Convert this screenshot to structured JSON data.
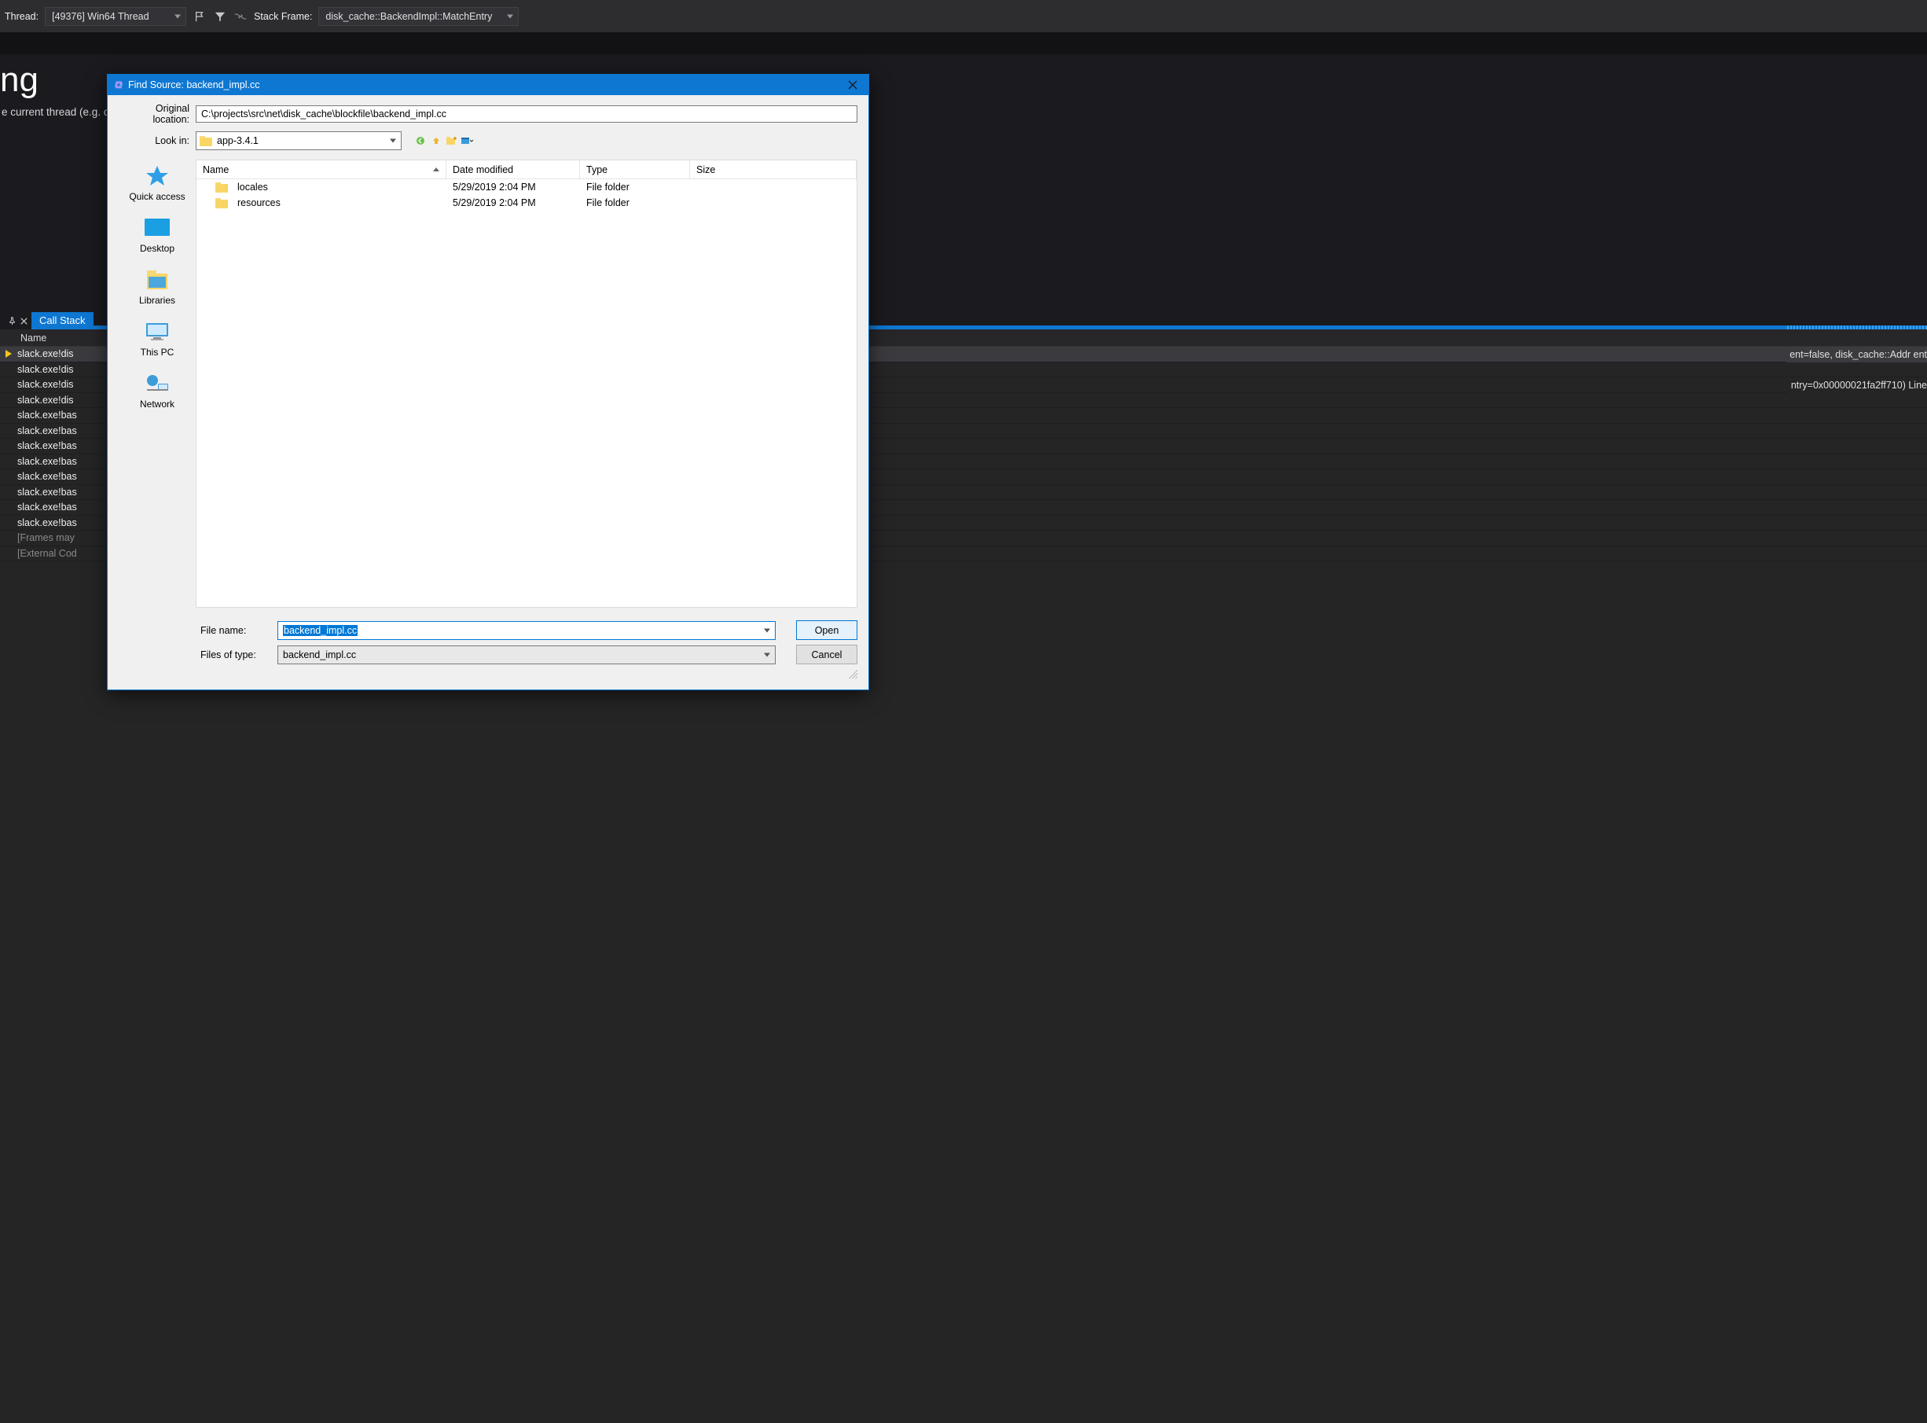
{
  "toolbar": {
    "thread_label": "Thread:",
    "thread_value": "[49376] Win64 Thread",
    "stack_label": "Stack Frame:",
    "stack_value": "disk_cache::BackendImpl::MatchEntry"
  },
  "main": {
    "big": "ng",
    "sub": "e current thread (e.g. on"
  },
  "callstack": {
    "tab": "Call Stack",
    "header": "Name",
    "rows": [
      {
        "text": "slack.exe!dis",
        "sel": true,
        "arrow": true
      },
      {
        "text": "slack.exe!dis"
      },
      {
        "text": "slack.exe!dis"
      },
      {
        "text": "slack.exe!dis"
      },
      {
        "text": "slack.exe!bas"
      },
      {
        "text": "slack.exe!bas"
      },
      {
        "text": "slack.exe!bas"
      },
      {
        "text": "slack.exe!bas"
      },
      {
        "text": "slack.exe!bas"
      },
      {
        "text": "slack.exe!bas"
      },
      {
        "text": "slack.exe!bas"
      },
      {
        "text": "slack.exe!bas"
      },
      {
        "text": "[Frames may",
        "dim": true
      },
      {
        "text": "[External Cod",
        "dim": true
      }
    ],
    "right_fragment_1": "ent=false, disk_cache::Addr ent",
    "right_fragment_2": "ntry=0x00000021fa2ff710) Line"
  },
  "dialog": {
    "title": "Find Source: backend_impl.cc",
    "orig_label": "Original location:",
    "orig_value": "C:\\projects\\src\\net\\disk_cache\\blockfile\\backend_impl.cc",
    "lookin_label": "Look in:",
    "lookin_value": "app-3.4.1",
    "columns": {
      "name": "Name",
      "date": "Date modified",
      "type": "Type",
      "size": "Size"
    },
    "files": [
      {
        "name": "locales",
        "date": "5/29/2019 2:04 PM",
        "type": "File folder"
      },
      {
        "name": "resources",
        "date": "5/29/2019 2:04 PM",
        "type": "File folder"
      }
    ],
    "places": {
      "quick": "Quick access",
      "desktop": "Desktop",
      "libraries": "Libraries",
      "thispc": "This PC",
      "network": "Network"
    },
    "filename_label": "File name:",
    "filename_value": "backend_impl.cc",
    "type_label": "Files of type:",
    "type_value": "backend_impl.cc",
    "open": "Open",
    "cancel": "Cancel"
  }
}
